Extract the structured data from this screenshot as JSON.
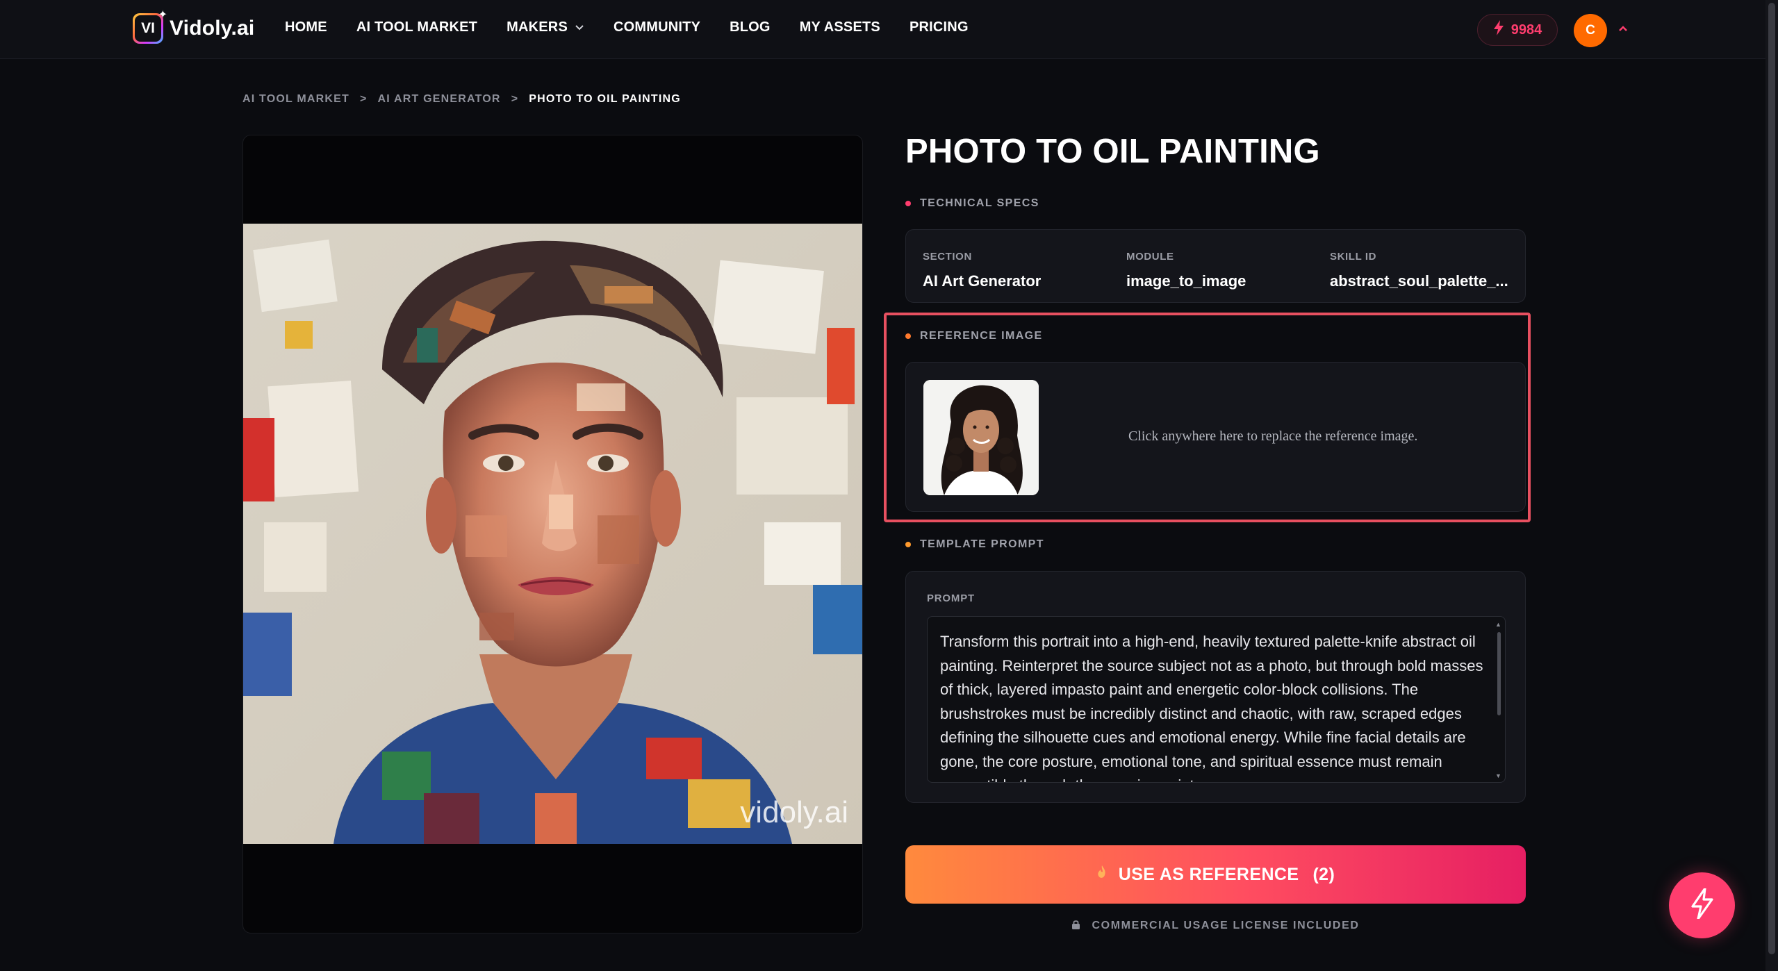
{
  "brand": {
    "name": "Vidoly.ai",
    "mark": "VI"
  },
  "nav": {
    "items": [
      {
        "label": "HOME"
      },
      {
        "label": "AI TOOL MARKET"
      },
      {
        "label": "MAKERS"
      },
      {
        "label": "COMMUNITY"
      },
      {
        "label": "BLOG"
      },
      {
        "label": "MY ASSETS"
      },
      {
        "label": "PRICING"
      }
    ],
    "credits": "9984",
    "avatar_initial": "C"
  },
  "breadcrumb": {
    "items": [
      "AI TOOL MARKET",
      "AI ART GENERATOR",
      "PHOTO TO OIL PAINTING"
    ],
    "separator": ">"
  },
  "preview": {
    "watermark": "vidoly.ai"
  },
  "tool": {
    "title": "PHOTO TO OIL PAINTING",
    "technical_specs_label": "TECHNICAL SPECS",
    "specs": [
      {
        "key": "SECTION",
        "value": "AI Art Generator"
      },
      {
        "key": "MODULE",
        "value": "image_to_image"
      },
      {
        "key": "SKILL ID",
        "value": "abstract_soul_palette_..."
      }
    ],
    "reference_label": "REFERENCE IMAGE",
    "reference_hint": "Click anywhere here to replace the reference image.",
    "template_prompt_label": "TEMPLATE PROMPT",
    "prompt_field_label": "PROMPT",
    "prompt_text": "Transform this portrait into a high-end, heavily textured palette-knife abstract oil painting. Reinterpret the source subject not as a photo, but through bold masses of thick, layered impasto paint and energetic color-block collisions. The brushstrokes must be incredibly distinct and chaotic, with raw, scraped edges defining the silhouette cues and emotional energy. While fine facial details are gone, the core posture, emotional tone, and spiritual essence must remain perceptible through the massive paint",
    "cta_label": "USE AS REFERENCE",
    "cta_count": "(2)",
    "license_text": "COMMERCIAL USAGE LICENSE INCLUDED"
  },
  "colors": {
    "accent": "#ff3d6e",
    "orange": "#ff6a00",
    "highlight_border": "#e85060",
    "background": "#0b0c10"
  }
}
